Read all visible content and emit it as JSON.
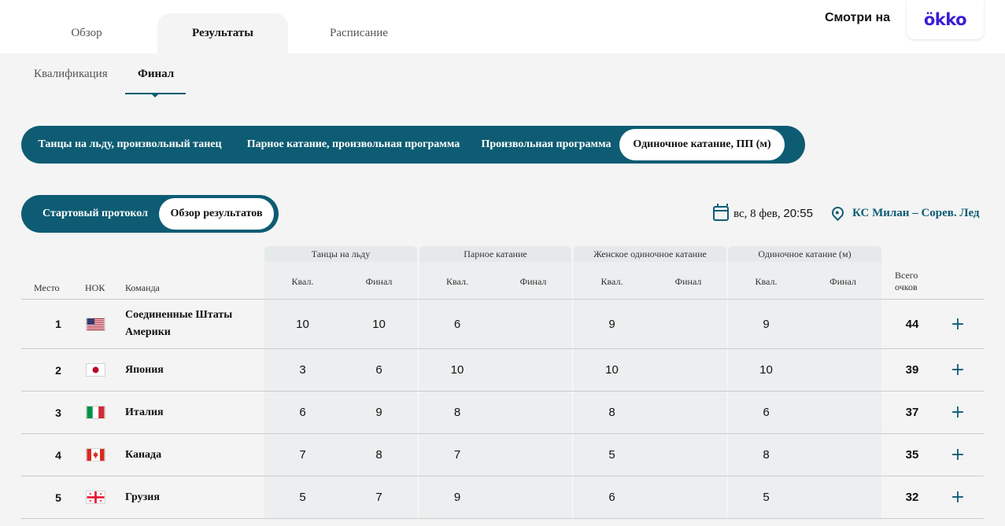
{
  "top_tabs": [
    "Обзор",
    "Результаты",
    "Расписание"
  ],
  "watch": {
    "label": "Смотри на",
    "brand": "ökko",
    "brand_color": "#3b1dd6"
  },
  "sub_tabs": [
    "Квалификация",
    "Финал"
  ],
  "events": [
    "Танцы на льду, произвольный танец",
    "Парное катание, произвольная программа",
    "Произвольная программа",
    "Одиночное катание, ПП (м)"
  ],
  "views": [
    "Стартовый протокол",
    "Обзор результатов"
  ],
  "session": {
    "date_day": "вс, 8 фев, ",
    "date_time": "20:55",
    "venue": "КС Милан – Сорев. Лед"
  },
  "table": {
    "col_place": "Место",
    "col_noc": "НОК",
    "col_team": "Команда",
    "groups": [
      "Танцы на льду",
      "Парное катание",
      "Женское одиночное катание",
      "Одиночное катание (м)"
    ],
    "sub_qual": "Квал.",
    "sub_final": "Финал",
    "col_total_1": "Всего",
    "col_total_2": "очков",
    "rows": [
      {
        "place": "1",
        "noc": "USA",
        "team_1": "Соединенные Штаты",
        "team_2": "Америки",
        "g1q": "10",
        "g1f": "10",
        "g2q": "6",
        "g2f": "",
        "g3q": "9",
        "g3f": "",
        "g4q": "9",
        "g4f": "",
        "total": "44"
      },
      {
        "place": "2",
        "noc": "JPN",
        "team_1": "Япония",
        "team_2": "",
        "g1q": "3",
        "g1f": "6",
        "g2q": "10",
        "g2f": "",
        "g3q": "10",
        "g3f": "",
        "g4q": "10",
        "g4f": "",
        "total": "39"
      },
      {
        "place": "3",
        "noc": "ITA",
        "team_1": "Италия",
        "team_2": "",
        "g1q": "6",
        "g1f": "9",
        "g2q": "8",
        "g2f": "",
        "g3q": "8",
        "g3f": "",
        "g4q": "6",
        "g4f": "",
        "total": "37"
      },
      {
        "place": "4",
        "noc": "CAN",
        "team_1": "Канада",
        "team_2": "",
        "g1q": "7",
        "g1f": "8",
        "g2q": "7",
        "g2f": "",
        "g3q": "5",
        "g3f": "",
        "g4q": "8",
        "g4f": "",
        "total": "35"
      },
      {
        "place": "5",
        "noc": "GEO",
        "team_1": "Грузия",
        "team_2": "",
        "g1q": "5",
        "g1f": "7",
        "g2q": "9",
        "g2f": "",
        "g3q": "6",
        "g3f": "",
        "g4q": "5",
        "g4f": "",
        "total": "32"
      }
    ],
    "expand_symbol": "+"
  },
  "colors": {
    "accent": "#0d5c73",
    "page_bg": "#f4f4f4"
  }
}
